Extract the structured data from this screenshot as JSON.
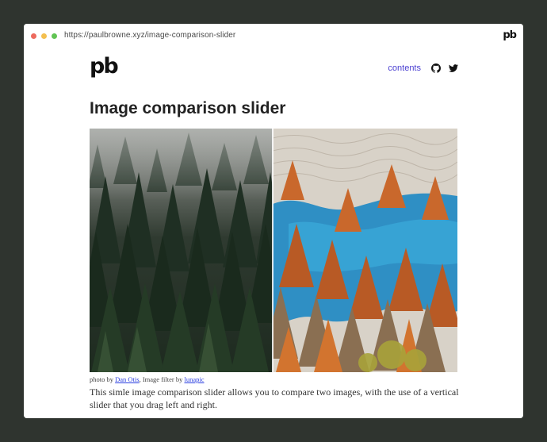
{
  "browser": {
    "url": "https://paulbrowne.xyz/image-comparison-slider",
    "tab_logo": "pb",
    "traffic_lights": {
      "close": "#ed6a5e",
      "minimize": "#f4bf4f",
      "maximize": "#61c454"
    }
  },
  "header": {
    "logo": "pb",
    "nav": {
      "contents_label": "contents",
      "github_icon": "github-icon",
      "twitter_icon": "twitter-icon"
    }
  },
  "main": {
    "title": "Image comparison slider",
    "caption": {
      "prefix": "photo by ",
      "photographer": "Dan Otis",
      "middle": ", Image filter by ",
      "filter_credit": "lunapic"
    },
    "description": "This simle image comparison slider allows you to compare two images, with the use of a vertical slider that you drag left and right."
  },
  "colors": {
    "link": "#4a3fd1",
    "background": "#2f342f"
  }
}
